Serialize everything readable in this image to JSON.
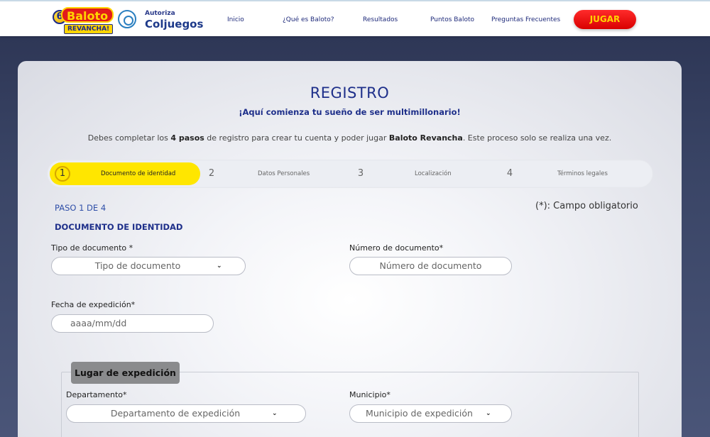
{
  "header": {
    "logo_text": "Baloto",
    "logo_sub": "REVANCHA!",
    "authorized_by": "Autoriza",
    "regulator": "Coljuegos",
    "nav": [
      "Inicio",
      "¿Qué es Baloto?",
      "Resultados",
      "Puntos Baloto",
      "Preguntas Frecuentes"
    ],
    "cta": "JUGAR"
  },
  "page": {
    "title": "REGISTRO",
    "subtitle": "¡Aquí comienza tu sueño de ser multimillonario!",
    "intro_before": "Debes completar los ",
    "intro_steps": "4 pasos",
    "intro_middle": " de registro para crear tu cuenta y poder jugar ",
    "intro_game": "Baloto Revancha",
    "intro_after": ". Este proceso solo se realiza una vez."
  },
  "stepper": [
    {
      "num": "1",
      "label": "Documento de identidad",
      "active": true
    },
    {
      "num": "2",
      "label": "Datos Personales",
      "active": false
    },
    {
      "num": "3",
      "label": "Localización",
      "active": false
    },
    {
      "num": "4",
      "label": "Términos legales",
      "active": false
    }
  ],
  "form": {
    "step_indicator": "PASO 1 DE 4",
    "required_note": "(*): Campo obligatorio",
    "section_title": "DOCUMENTO DE IDENTIDAD",
    "doc_type": {
      "label": "Tipo de documento *",
      "placeholder": "Tipo de documento"
    },
    "doc_number": {
      "label": "Número de documento*",
      "placeholder": "Número de documento"
    },
    "issue_date": {
      "label": "Fecha de expedición*",
      "placeholder": "aaaa/mm/dd"
    },
    "place": {
      "title": "Lugar de expedición",
      "department": {
        "label": "Departamento*",
        "placeholder": "Departamento de expedición"
      },
      "municipality": {
        "label": "Municipio*",
        "placeholder": "Municipio de expedición"
      }
    }
  },
  "colors": {
    "brand_blue": "#1e2f8a",
    "accent_yellow": "#ffe600",
    "cta_red": "#e21b1b"
  },
  "icons": [
    "chevron-down-icon",
    "coljuegos-seal-icon",
    "baloto-ball-icon"
  ]
}
